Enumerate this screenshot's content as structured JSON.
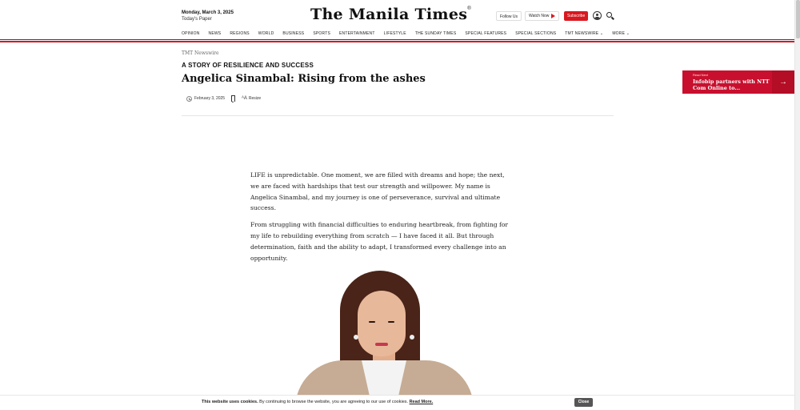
{
  "header": {
    "date": "Monday, March 3, 2025",
    "todays_paper": "Today's Paper",
    "logo": "The Manila Times",
    "logo_mark": "®",
    "follow_us": "Follow Us",
    "watch_now": "Watch Now",
    "subscribe": "Subscribe"
  },
  "nav": {
    "items": [
      "OPINION",
      "NEWS",
      "REGIONS",
      "WORLD",
      "BUSINESS",
      "SPORTS",
      "ENTERTAINMENT",
      "LIFESTYLE",
      "THE SUNDAY TIMES",
      "SPECIAL FEATURES",
      "SPECIAL SECTIONS",
      "TMT NEWSWIRE",
      "MORE"
    ]
  },
  "article": {
    "section": "TMT Newswire",
    "kicker": "A STORY OF RESILIENCE AND SUCCESS",
    "headline": "Angelica Sinambal: Rising from the ashes",
    "date": "February 3, 2025",
    "resize_label": "Resize",
    "paragraphs": [
      "LIFE is unpredictable. One moment, we are filled with dreams and hope; the next, we are faced with hardships that test our strength and willpower. My name is Angelica Sinambal, and my journey is one of perseverance, survival and ultimate success.",
      "From struggling with financial difficulties to enduring heartbreak, from fighting for my life to rebuilding everything from scratch — I have faced it all. But through determination, faith and the ability to adapt, I transformed every challenge into an opportunity."
    ]
  },
  "read_next": {
    "label": "Read Next",
    "title": "Infobip partners with NTT Com Online to...",
    "arrow": "→"
  },
  "cookie": {
    "bold": "This website uses cookies.",
    "text": " By continuing to browse the website, you are agreeing to our use of cookies. ",
    "link": "Read More.",
    "close": "Close"
  },
  "colors": {
    "brand_red": "#d71920",
    "brand_blue": "#1c3f94",
    "read_next_bg": "#c8102e"
  }
}
